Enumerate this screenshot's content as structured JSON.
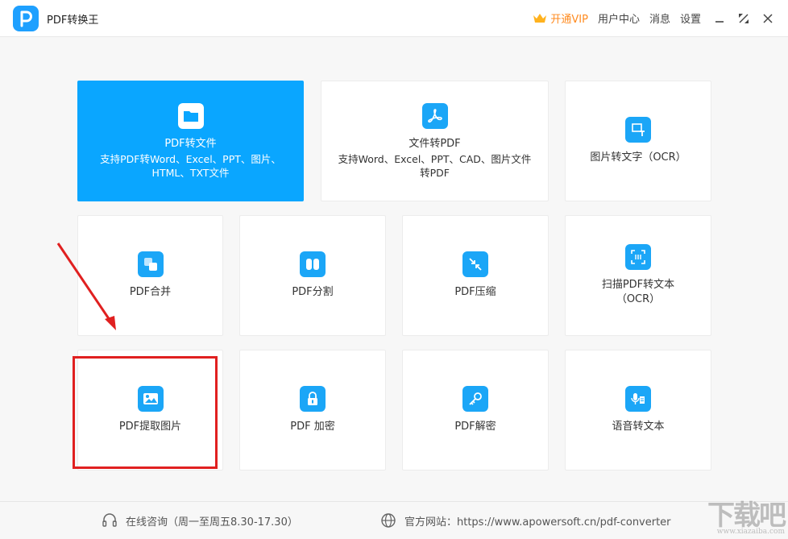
{
  "app": {
    "title": "PDF转换王"
  },
  "header": {
    "vip_label": "开通VIP",
    "user_center": "用户中心",
    "messages": "消息",
    "settings": "设置"
  },
  "cards": {
    "pdf_to_file": {
      "title": "PDF转文件",
      "desc": "支持PDF转Word、Excel、PPT、图片、HTML、TXT文件"
    },
    "file_to_pdf": {
      "title": "文件转PDF",
      "desc": "支持Word、Excel、PPT、CAD、图片文件转PDF"
    },
    "image_to_text": {
      "title": "图片转文字（OCR）"
    },
    "pdf_merge": {
      "title": "PDF合并"
    },
    "pdf_split": {
      "title": "PDF分割"
    },
    "pdf_compress": {
      "title": "PDF压缩"
    },
    "scan_pdf_to_text": {
      "title": "扫描PDF转文本（OCR）"
    },
    "pdf_extract_images": {
      "title": "PDF提取图片"
    },
    "pdf_encrypt": {
      "title": "PDF 加密"
    },
    "pdf_decrypt": {
      "title": "PDF解密"
    },
    "speech_to_text": {
      "title": "语音转文本"
    }
  },
  "footer": {
    "consult": "在线咨询（周一至周五8.30-17.30）",
    "website": "官方网站：https://www.apowersoft.cn/pdf-converter"
  },
  "watermark": {
    "text": "下载吧",
    "small": "www.xiazaiba.com"
  },
  "colors": {
    "accent": "#0aa6ff",
    "icon": "#1ba6f7",
    "vip": "#ff8a1e",
    "highlight": "#e02020"
  }
}
